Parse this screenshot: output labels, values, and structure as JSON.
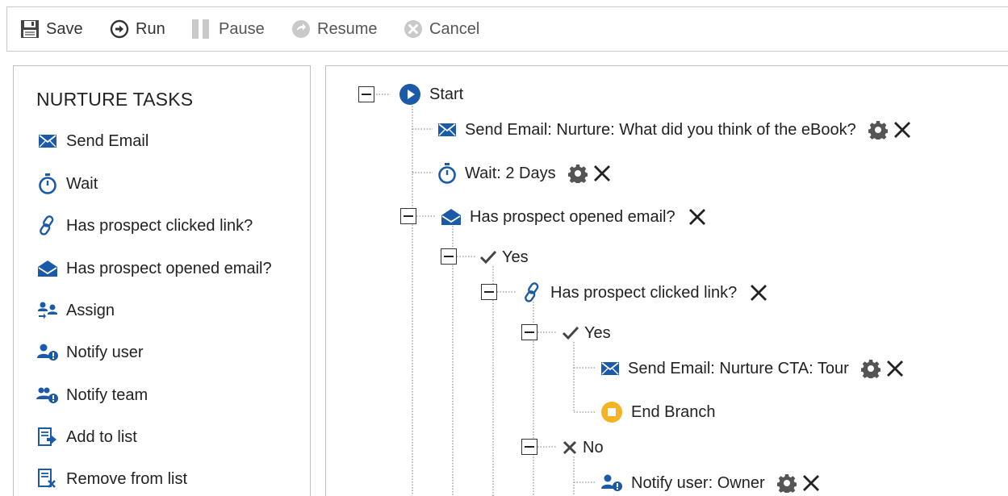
{
  "toolbar": {
    "save": "Save",
    "run": "Run",
    "pause": "Pause",
    "resume": "Resume",
    "cancel": "Cancel"
  },
  "tasks_panel": {
    "title": "NURTURE TASKS",
    "items": [
      {
        "label": "Send Email",
        "icon": "envelope-icon"
      },
      {
        "label": "Wait",
        "icon": "stopwatch-icon"
      },
      {
        "label": "Has prospect clicked link?",
        "icon": "link-icon"
      },
      {
        "label": "Has prospect opened email?",
        "icon": "open-envelope-icon"
      },
      {
        "label": "Assign",
        "icon": "assign-users-icon"
      },
      {
        "label": "Notify user",
        "icon": "notify-user-icon"
      },
      {
        "label": "Notify team",
        "icon": "notify-team-icon"
      },
      {
        "label": "Add to list",
        "icon": "add-to-list-icon"
      },
      {
        "label": "Remove from list",
        "icon": "remove-from-list-icon"
      }
    ]
  },
  "flow": {
    "start": "Start",
    "send_email_1": "Send Email: Nurture: What did you think of the eBook?",
    "wait_1": "Wait: 2 Days",
    "opened_check": "Has prospect opened email?",
    "yes_1": "Yes",
    "clicked_check": "Has prospect clicked link?",
    "yes_2": "Yes",
    "send_email_2": "Send Email: Nurture CTA: Tour",
    "end_branch": "End Branch",
    "no_1": "No",
    "notify_user": "Notify user: Owner"
  },
  "colors": {
    "accent_blue": "#1a5aa8",
    "end_orange": "#f5b324",
    "icon_gray": "#555555"
  }
}
